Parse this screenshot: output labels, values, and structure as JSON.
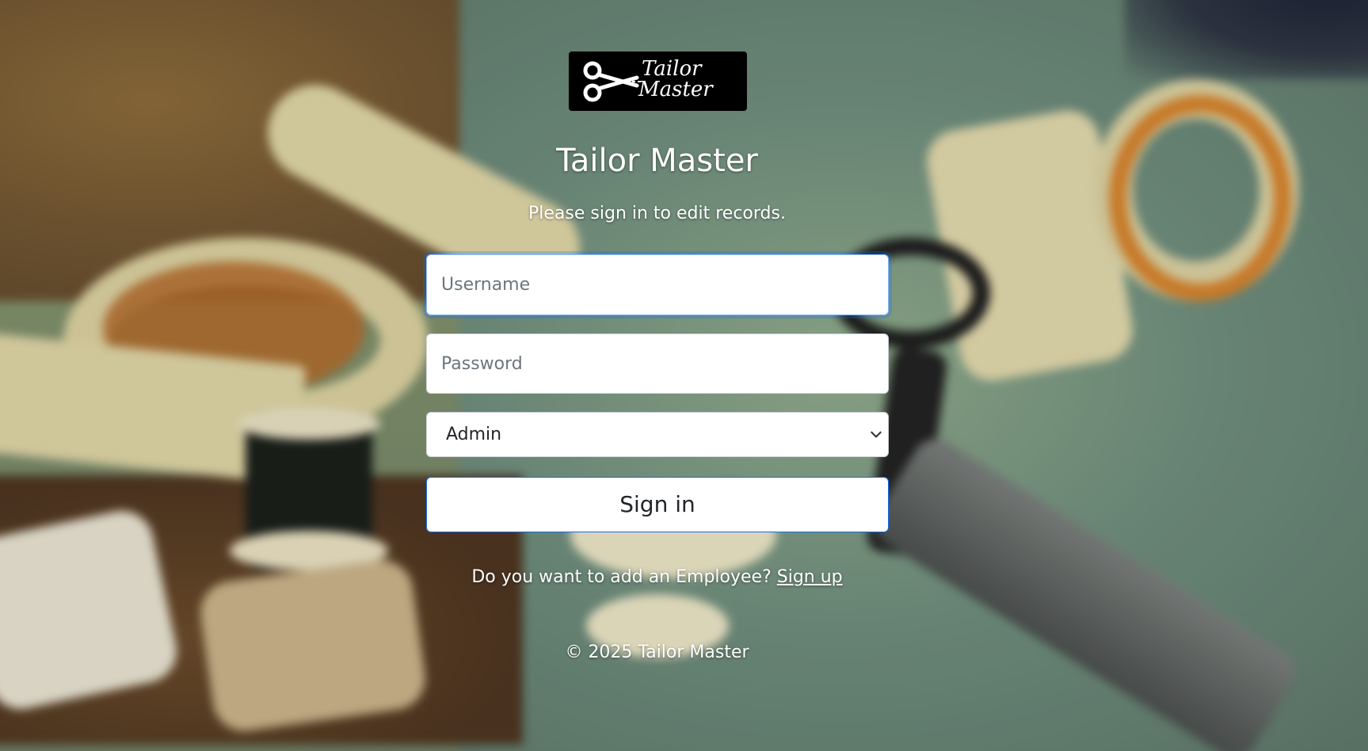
{
  "brand": {
    "logo_line1": "Tailor",
    "logo_line2": "Master",
    "title": "Tailor Master",
    "subtitle": "Please sign in to edit records."
  },
  "form": {
    "username_placeholder": "Username",
    "password_placeholder": "Password",
    "role_selected": "Admin",
    "submit_label": "Sign in"
  },
  "signup": {
    "prompt": "Do you want to add an Employee?",
    "link_label": "Sign up"
  },
  "footer": {
    "text": "© 2025 Tailor Master"
  },
  "icons": {
    "logo": "scissors-icon",
    "select_arrow": "chevron-down-icon"
  },
  "colors": {
    "focus_ring": "#86b7fe",
    "primary_border": "#0d6efd",
    "logo_background": "#000000"
  }
}
